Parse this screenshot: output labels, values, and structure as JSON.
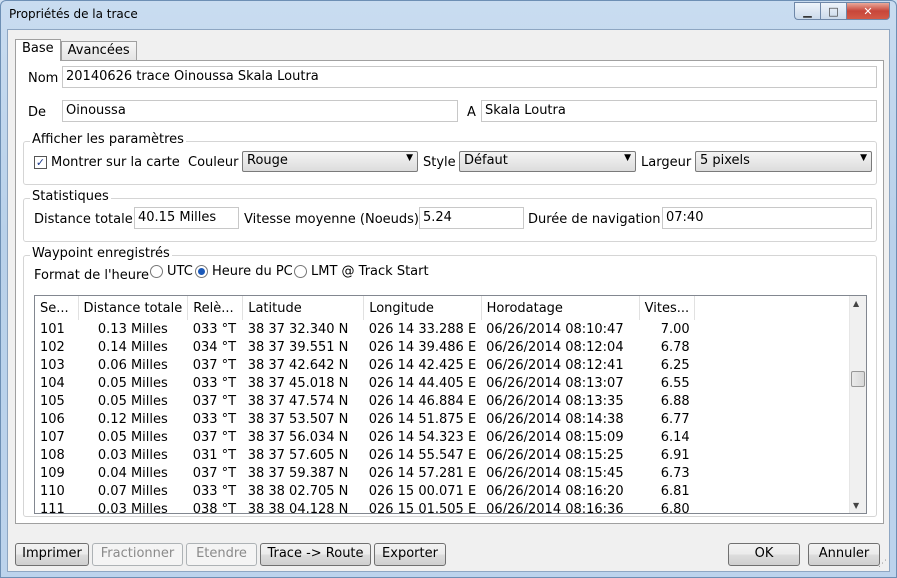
{
  "window": {
    "title": "Propriétés de la trace",
    "minimize_glyph": "▁",
    "maximize_glyph": "□",
    "close_glyph": "✕"
  },
  "tabs": [
    {
      "label": "Base"
    },
    {
      "label": "Avancées"
    }
  ],
  "form": {
    "name_label": "Nom",
    "name_value": "20140626 trace Oinoussa Skala Loutra",
    "from_label": "De",
    "from_value": "Oinoussa",
    "to_label": "A",
    "to_value": "Skala Loutra"
  },
  "display": {
    "group_title": "Afficher les paramètres",
    "show_on_map_label": "Montrer sur la carte",
    "show_on_map_checked": true,
    "color_label": "Couleur",
    "color_value": "Rouge",
    "style_label": "Style",
    "style_value": "Défaut",
    "width_label": "Largeur",
    "width_value": "5 pixels"
  },
  "stats": {
    "group_title": "Statistiques",
    "distance_label": "Distance totale",
    "distance_value": "40.15 Milles",
    "speed_label": "Vitesse moyenne (Noeuds)",
    "speed_value": "5.24",
    "duration_label": "Durée de navigation",
    "duration_value": "07:40"
  },
  "waypoints": {
    "group_title": "Waypoint enregistrés",
    "time_format_label": "Format de l'heure",
    "time_options": [
      {
        "label": "UTC",
        "selected": false
      },
      {
        "label": "Heure du PC",
        "selected": true
      },
      {
        "label": "LMT @ Track Start",
        "selected": false
      }
    ],
    "columns": [
      "Se...",
      "Distance totale",
      "Relè...",
      "Latitude",
      "Longitude",
      "Horodatage",
      "Vites..."
    ],
    "rows": [
      [
        "101",
        "0.13 Milles",
        "033 °T",
        "38 37 32.340 N",
        "026 14 33.288 E",
        "06/26/2014 08:10:47",
        "7.00"
      ],
      [
        "102",
        "0.14 Milles",
        "034 °T",
        "38 37 39.551 N",
        "026 14 39.486 E",
        "06/26/2014 08:12:04",
        "6.78"
      ],
      [
        "103",
        "0.06 Milles",
        "037 °T",
        "38 37 42.642 N",
        "026 14 42.425 E",
        "06/26/2014 08:12:41",
        "6.25"
      ],
      [
        "104",
        "0.05 Milles",
        "033 °T",
        "38 37 45.018 N",
        "026 14 44.405 E",
        "06/26/2014 08:13:07",
        "6.55"
      ],
      [
        "105",
        "0.05 Milles",
        "037 °T",
        "38 37 47.574 N",
        "026 14 46.884 E",
        "06/26/2014 08:13:35",
        "6.88"
      ],
      [
        "106",
        "0.12 Milles",
        "033 °T",
        "38 37 53.507 N",
        "026 14 51.875 E",
        "06/26/2014 08:14:38",
        "6.77"
      ],
      [
        "107",
        "0.05 Milles",
        "037 °T",
        "38 37 56.034 N",
        "026 14 54.323 E",
        "06/26/2014 08:15:09",
        "6.14"
      ],
      [
        "108",
        "0.03 Milles",
        "031 °T",
        "38 37 57.605 N",
        "026 14 55.547 E",
        "06/26/2014 08:15:25",
        "6.91"
      ],
      [
        "109",
        "0.04 Milles",
        "037 °T",
        "38 37 59.387 N",
        "026 14 57.281 E",
        "06/26/2014 08:15:45",
        "6.73"
      ],
      [
        "110",
        "0.07 Milles",
        "033 °T",
        "38 38 02.705 N",
        "026 15 00.071 E",
        "06/26/2014 08:16:20",
        "6.81"
      ],
      [
        "111",
        "0.03 Milles",
        "038 °T",
        "38 38 04.128 N",
        "026 15 01.505 E",
        "06/26/2014 08:16:36",
        "6.80"
      ]
    ]
  },
  "buttons": {
    "print": "Imprimer",
    "split": "Fractionner",
    "extend": "Etendre",
    "to_route": "Trace -> Route",
    "export": "Exporter",
    "ok": "OK",
    "cancel": "Annuler"
  }
}
